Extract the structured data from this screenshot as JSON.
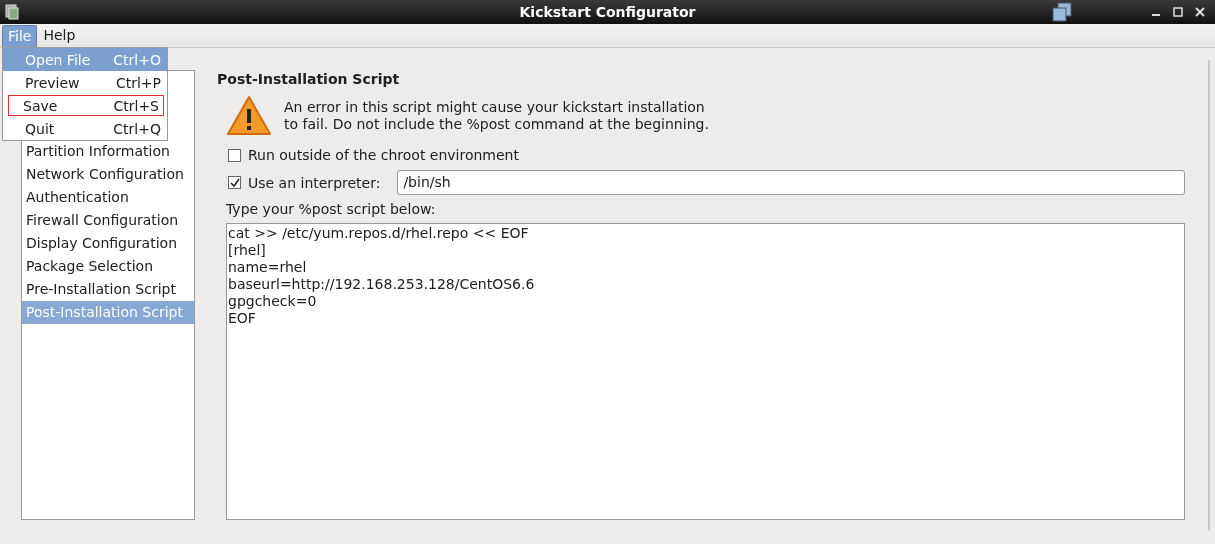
{
  "window": {
    "title": "Kickstart Configurator"
  },
  "menu_bar": [
    {
      "label": "File",
      "selected": true
    },
    {
      "label": "Help",
      "selected": false
    }
  ],
  "file_menu": [
    {
      "label": "Open File",
      "shortcut": "Ctrl+O",
      "selected": true,
      "marked": false
    },
    {
      "label": "Preview",
      "shortcut": "Ctrl+P",
      "selected": false,
      "marked": false
    },
    {
      "label": "Save",
      "shortcut": "Ctrl+S",
      "selected": false,
      "marked": true
    },
    {
      "label": "Quit",
      "shortcut": "Ctrl+Q",
      "selected": false,
      "marked": false
    }
  ],
  "sidebar": {
    "items": [
      {
        "label": "Partition Information",
        "selected": false
      },
      {
        "label": "Network Configuration",
        "selected": false
      },
      {
        "label": "Authentication",
        "selected": false
      },
      {
        "label": "Firewall Configuration",
        "selected": false
      },
      {
        "label": "Display Configuration",
        "selected": false
      },
      {
        "label": "Package Selection",
        "selected": false
      },
      {
        "label": "Pre-Installation Script",
        "selected": false
      },
      {
        "label": "Post-Installation Script",
        "selected": true
      }
    ]
  },
  "panel": {
    "title": "Post-Installation Script",
    "warning": "An error in this script might cause your kickstart installation\nto fail. Do not include the %post command at the beginning.",
    "run_outside_chroot": {
      "label": "Run outside of the chroot environment",
      "checked": false
    },
    "use_interpreter": {
      "label": "Use an interpreter:",
      "checked": true,
      "value": "/bin/sh"
    },
    "script_label": "Type your %post script below:",
    "script": "cat >> /etc/yum.repos.d/rhel.repo << EOF\n[rhel]\nname=rhel\nbaseurl=http://192.168.253.128/CentOS6.6\ngpgcheck=0\nEOF"
  }
}
